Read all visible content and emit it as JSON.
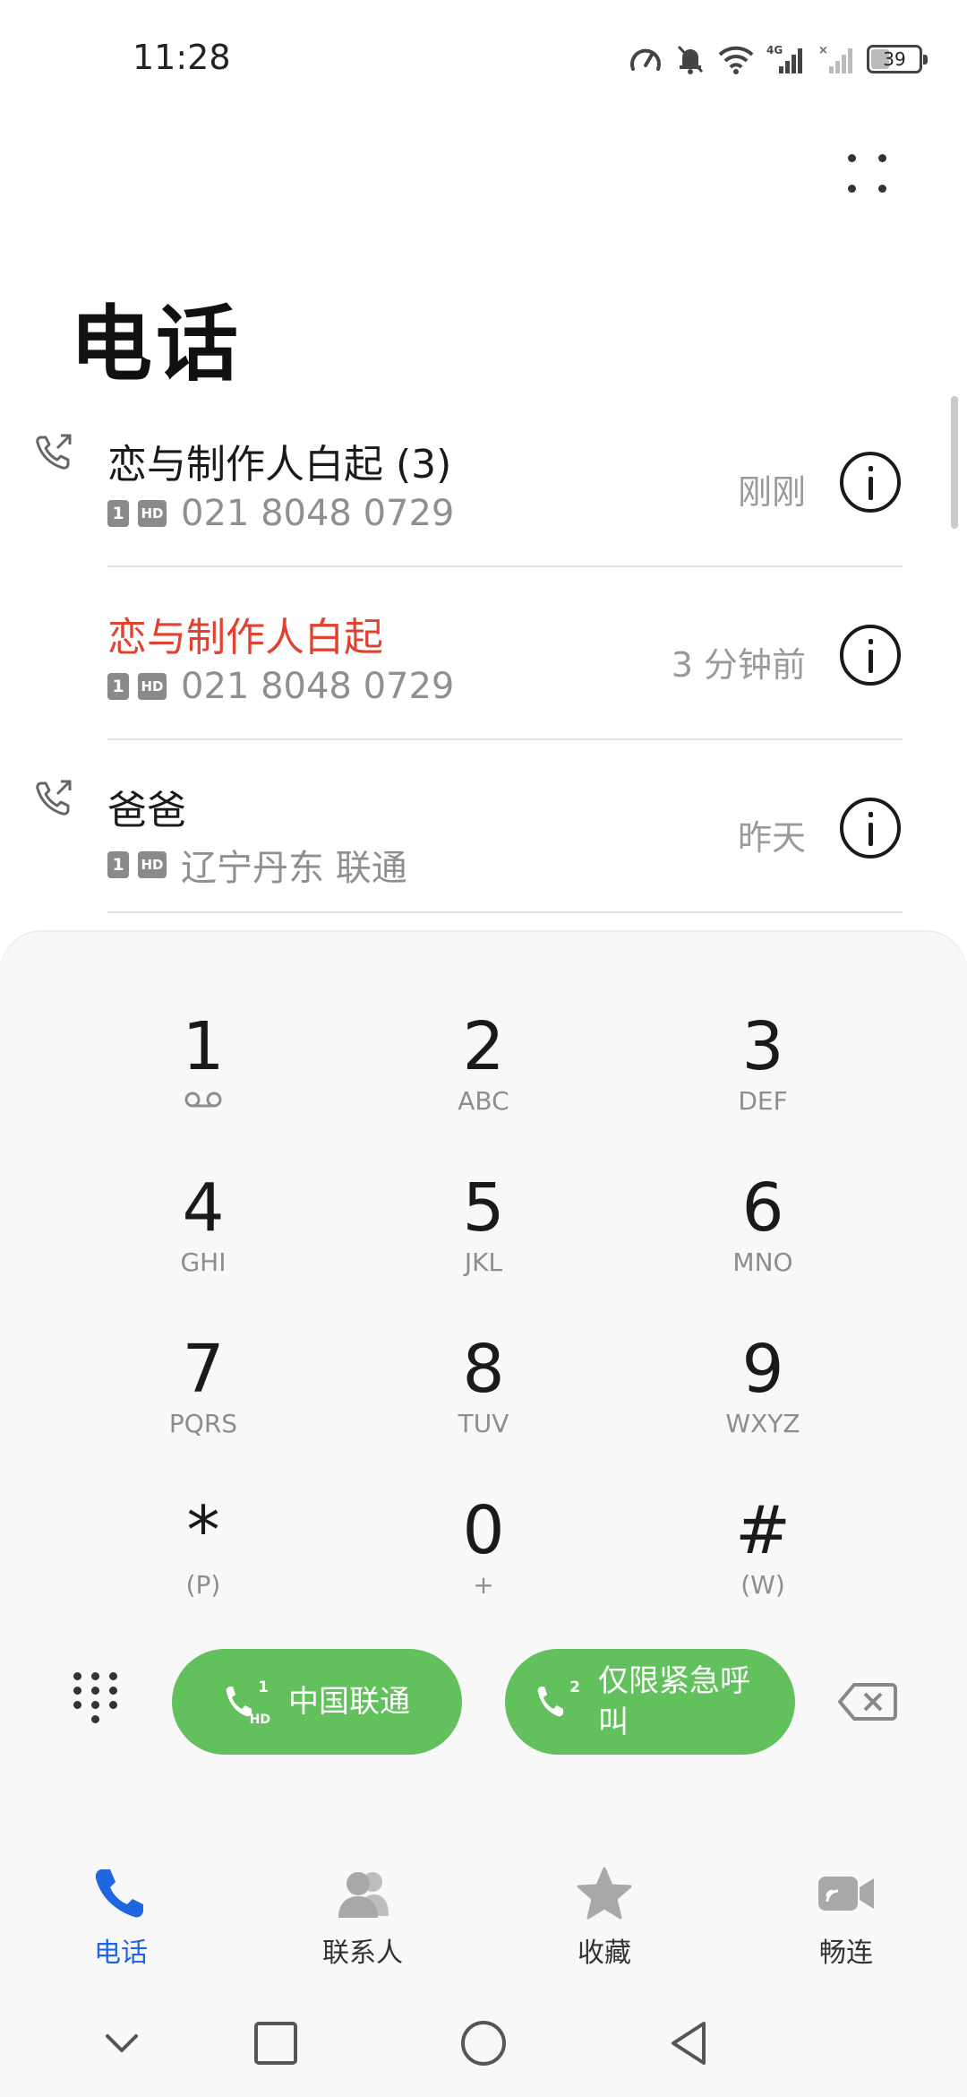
{
  "status_bar": {
    "time": "11:28",
    "network": "4G",
    "battery": "39",
    "battery_level_percent": 39
  },
  "header": {
    "title": "电话",
    "more_icon": "more-dots-icon"
  },
  "call_log": [
    {
      "name": "恋与制作人白起 (3)",
      "missed": false,
      "sim": "1",
      "hd": "HD",
      "detail": "021 8048 0729",
      "time": "刚刚",
      "type_icon": "outgoing-call-icon"
    },
    {
      "name": "恋与制作人白起",
      "missed": true,
      "sim": "1",
      "hd": "HD",
      "detail": "021 8048 0729",
      "time": "3 分钟前",
      "type_icon": ""
    },
    {
      "name": "爸爸",
      "missed": false,
      "sim": "1",
      "hd": "HD",
      "detail": "辽宁丹东 联通",
      "time": "昨天",
      "type_icon": "outgoing-call-icon"
    }
  ],
  "dialpad": {
    "keys": [
      {
        "digit": "1",
        "letters": ""
      },
      {
        "digit": "2",
        "letters": "ABC"
      },
      {
        "digit": "3",
        "letters": "DEF"
      },
      {
        "digit": "4",
        "letters": "GHI"
      },
      {
        "digit": "5",
        "letters": "JKL"
      },
      {
        "digit": "6",
        "letters": "MNO"
      },
      {
        "digit": "7",
        "letters": "PQRS"
      },
      {
        "digit": "8",
        "letters": "TUV"
      },
      {
        "digit": "9",
        "letters": "WXYZ"
      },
      {
        "digit": "*",
        "letters": "(P)"
      },
      {
        "digit": "0",
        "letters": "+"
      },
      {
        "digit": "#",
        "letters": "(W)"
      }
    ],
    "call_sim1": {
      "sim": "1",
      "hd": "HD",
      "label": "中国联通"
    },
    "call_sim2": {
      "sim": "2",
      "label_line1": "仅限紧急呼",
      "label_line2": "叫"
    }
  },
  "bottom_nav": [
    {
      "label": "电话",
      "icon": "phone-icon",
      "active": true
    },
    {
      "label": "联系人",
      "icon": "contacts-icon",
      "active": false
    },
    {
      "label": "收藏",
      "icon": "star-icon",
      "active": false
    },
    {
      "label": "畅连",
      "icon": "video-call-icon",
      "active": false
    }
  ],
  "colors": {
    "accent": "#1f66e0",
    "call_green": "#63c15d",
    "missed_red": "#e1412e"
  }
}
